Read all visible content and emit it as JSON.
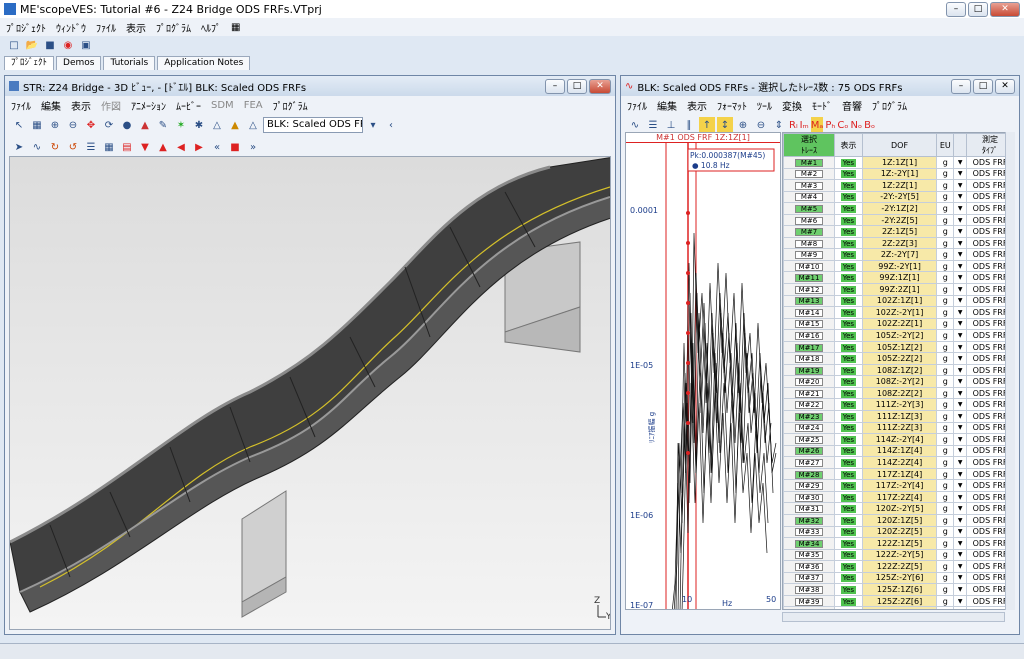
{
  "app": {
    "title": "ME'scopeVES: Tutorial #6 - Z24 Bridge ODS FRFs.VTprj"
  },
  "main_menu": [
    "ﾌﾟﾛｼﾞｪｸﾄ",
    "ｳｨﾝﾄﾞｳ",
    "ﾌｧｲﾙ",
    "表示",
    "ﾌﾟﾛｸﾞﾗﾑ",
    "ﾍﾙﾌﾟ"
  ],
  "tabs": [
    "ﾌﾟﾛｼﾞｪｸﾄ",
    "Demos",
    "Tutorials",
    "Application Notes"
  ],
  "str_window": {
    "title": "STR: Z24 Bridge - 3D ﾋﾞｭｰ, - [ﾄﾞｴﾙ] BLK: Scaled ODS FRFs",
    "menu": [
      "ﾌｧｲﾙ",
      "編集",
      "表示",
      "作図",
      "ｱﾆﾒｰｼｮﾝ",
      "ﾑｰﾋﾞｰ",
      "SDM",
      "FEA",
      "ﾌﾟﾛｸﾞﾗﾑ"
    ],
    "combo": "BLK: Scaled ODS FR"
  },
  "blk_window": {
    "title": "BLK: Scaled ODS FRFs - 選択したﾄﾚｰｽ数 : 75 ODS FRFs",
    "menu": [
      "ﾌｧｲﾙ",
      "編集",
      "表示",
      "ﾌｫｰﾏｯﾄ",
      "ﾂｰﾙ",
      "変換",
      "ﾓｰﾄﾞ",
      "音響",
      "ﾌﾟﾛｸﾞﾗﾑ"
    ],
    "toolbar_labels": [
      "Rₗ",
      "Iₘ",
      "Mₐ",
      "Pₕ",
      "Cₒ",
      "Nₒ",
      "Bₒ"
    ],
    "plot_title": "M#1  ODS  FRF 1Z:1Z[1]",
    "cursor_line1": "Pk:0.000387(M#45)",
    "cursor_line2": "● 10.8 Hz",
    "ylabel": "ﾘﾆｱ振幅 g",
    "xlabel": "Hz",
    "yticks": [
      "0.0001",
      "1E-05",
      "1E-06",
      "1E-07"
    ],
    "xticks": [
      "10",
      "50"
    ],
    "columns": [
      "選択\nﾄﾚｰｽ",
      "表示",
      "DOF",
      "EU",
      "",
      "測定\nﾀｲﾌﾟ"
    ],
    "rows": [
      {
        "m": "M#1",
        "sel": true,
        "dof": "1Z:1Z[1]"
      },
      {
        "m": "M#2",
        "sel": false,
        "dof": "1Z:-2Y[1]"
      },
      {
        "m": "M#3",
        "sel": false,
        "dof": "1Z:2Z[1]"
      },
      {
        "m": "M#4",
        "sel": false,
        "dof": "-2Y:-2Y[5]"
      },
      {
        "m": "M#5",
        "sel": true,
        "dof": "-2Y:1Z[2]"
      },
      {
        "m": "M#6",
        "sel": false,
        "dof": "-2Y:2Z[5]"
      },
      {
        "m": "M#7",
        "sel": true,
        "dof": "2Z:1Z[5]"
      },
      {
        "m": "M#8",
        "sel": false,
        "dof": "2Z:2Z[3]"
      },
      {
        "m": "M#9",
        "sel": false,
        "dof": "2Z:-2Y[7]"
      },
      {
        "m": "M#10",
        "sel": false,
        "dof": "99Z:-2Y[1]"
      },
      {
        "m": "M#11",
        "sel": true,
        "dof": "99Z:1Z[1]"
      },
      {
        "m": "M#12",
        "sel": false,
        "dof": "99Z:2Z[1]"
      },
      {
        "m": "M#13",
        "sel": true,
        "dof": "102Z:1Z[1]"
      },
      {
        "m": "M#14",
        "sel": false,
        "dof": "102Z:-2Y[1]"
      },
      {
        "m": "M#15",
        "sel": false,
        "dof": "102Z:2Z[1]"
      },
      {
        "m": "M#16",
        "sel": false,
        "dof": "105Z:-2Y[2]"
      },
      {
        "m": "M#17",
        "sel": true,
        "dof": "105Z:1Z[2]"
      },
      {
        "m": "M#18",
        "sel": false,
        "dof": "105Z:2Z[2]"
      },
      {
        "m": "M#19",
        "sel": true,
        "dof": "108Z:1Z[2]"
      },
      {
        "m": "M#20",
        "sel": false,
        "dof": "108Z:-2Y[2]"
      },
      {
        "m": "M#21",
        "sel": false,
        "dof": "108Z:2Z[2]"
      },
      {
        "m": "M#22",
        "sel": false,
        "dof": "111Z:-2Y[3]"
      },
      {
        "m": "M#23",
        "sel": true,
        "dof": "111Z:1Z[3]"
      },
      {
        "m": "M#24",
        "sel": false,
        "dof": "111Z:2Z[3]"
      },
      {
        "m": "M#25",
        "sel": false,
        "dof": "114Z:-2Y[4]"
      },
      {
        "m": "M#26",
        "sel": true,
        "dof": "114Z:1Z[4]"
      },
      {
        "m": "M#27",
        "sel": false,
        "dof": "114Z:2Z[4]"
      },
      {
        "m": "M#28",
        "sel": true,
        "dof": "117Z:1Z[4]"
      },
      {
        "m": "M#29",
        "sel": false,
        "dof": "117Z:-2Y[4]"
      },
      {
        "m": "M#30",
        "sel": false,
        "dof": "117Z:2Z[4]"
      },
      {
        "m": "M#31",
        "sel": false,
        "dof": "120Z:-2Y[5]"
      },
      {
        "m": "M#32",
        "sel": true,
        "dof": "120Z:1Z[5]"
      },
      {
        "m": "M#33",
        "sel": false,
        "dof": "120Z:2Z[5]"
      },
      {
        "m": "M#34",
        "sel": true,
        "dof": "122Z:1Z[5]"
      },
      {
        "m": "M#35",
        "sel": false,
        "dof": "122Z:-2Y[5]"
      },
      {
        "m": "M#36",
        "sel": false,
        "dof": "122Z:2Z[5]"
      },
      {
        "m": "M#37",
        "sel": false,
        "dof": "125Z:-2Y[6]"
      },
      {
        "m": "M#38",
        "sel": false,
        "dof": "125Z:1Z[6]"
      },
      {
        "m": "M#39",
        "sel": false,
        "dof": "125Z:2Z[6]"
      },
      {
        "m": "M#40",
        "sel": false,
        "dof": "128Z:1Z[6]"
      }
    ],
    "show_value": "Yes",
    "eu_value": "g",
    "type_value": "ODS FRF"
  },
  "axis_triad": {
    "z": "Z",
    "y": "Y"
  },
  "colors": {
    "accent": "#2b4f86",
    "show_green": "#4fc24f",
    "dof_yellow": "#f7e9a8",
    "trace_red": "#e0241c"
  }
}
